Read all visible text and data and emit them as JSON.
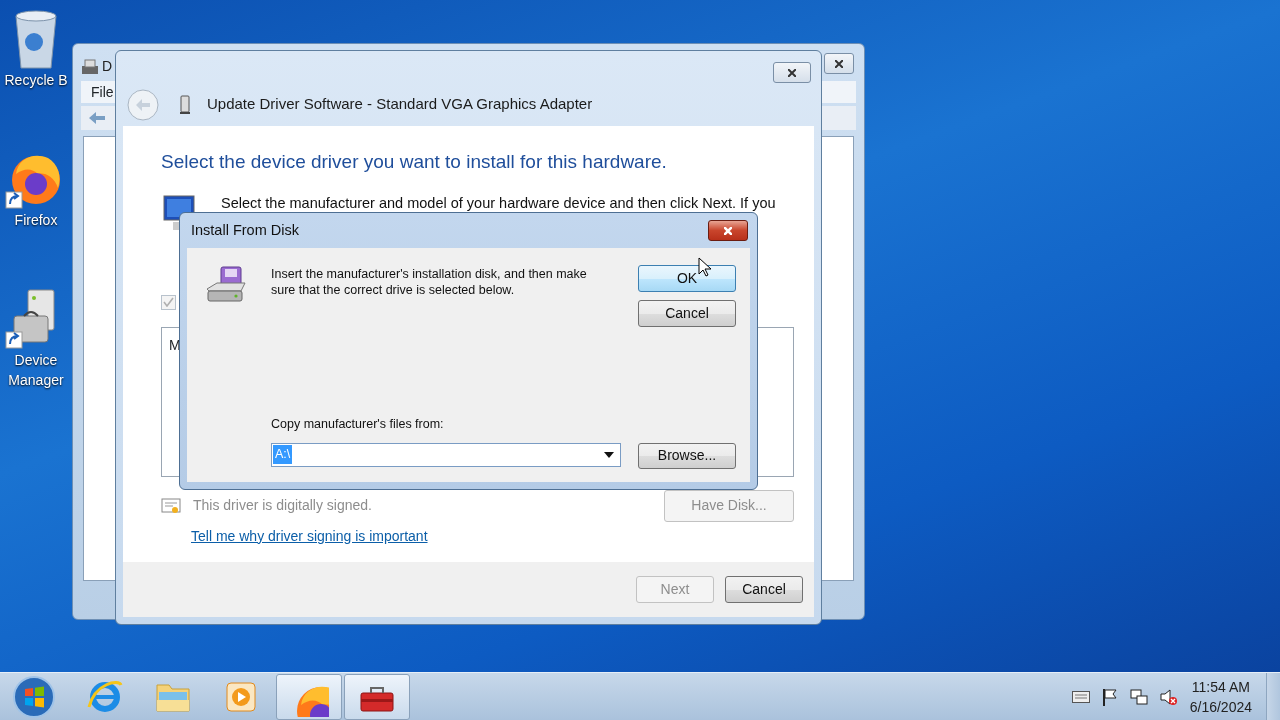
{
  "desktop_icons": [
    {
      "kind": "recycle",
      "label": "Recycle B",
      "shortcut": false
    },
    {
      "kind": "firefox",
      "label": "Firefox",
      "shortcut": true
    },
    {
      "kind": "devmgr",
      "label": "Device Manager",
      "shortcut": true
    }
  ],
  "background_window": {
    "title": "D",
    "menu": [
      "File"
    ]
  },
  "wizard": {
    "title": "Update Driver Software - Standard VGA Graphics Adapter",
    "heading": "Select the device driver you want to install for this hardware.",
    "instruction": "Select the manufacturer and model of your hardware device and then click Next. If you",
    "checkbox": {
      "checked": true,
      "disabled": true
    },
    "list_header": "M",
    "signed_text": "This driver is digitally signed.",
    "link": "Tell me why driver signing is important",
    "have_disk": {
      "label": "Have Disk...",
      "disabled": true
    },
    "buttons": [
      {
        "label": "Next",
        "disabled": true
      },
      {
        "label": "Cancel",
        "disabled": false
      }
    ]
  },
  "dialog": {
    "title": "Install From Disk",
    "message": "Insert the manufacturer's installation disk, and then make sure that the correct drive is selected below.",
    "buttons": [
      {
        "label": "OK",
        "default": true
      },
      {
        "label": "Cancel",
        "default": false
      }
    ],
    "field_label": "Copy manufacturer's files from:",
    "field_value": "A:\\",
    "browse": "Browse..."
  },
  "taskbar": {
    "buttons": [
      {
        "kind": "ie",
        "selected": false
      },
      {
        "kind": "folder",
        "selected": false
      },
      {
        "kind": "media",
        "selected": false
      },
      {
        "kind": "firefox",
        "selected": true
      },
      {
        "kind": "toolbox",
        "selected": true
      }
    ],
    "clock": {
      "time": "11:54 AM",
      "date": "6/16/2024"
    }
  }
}
